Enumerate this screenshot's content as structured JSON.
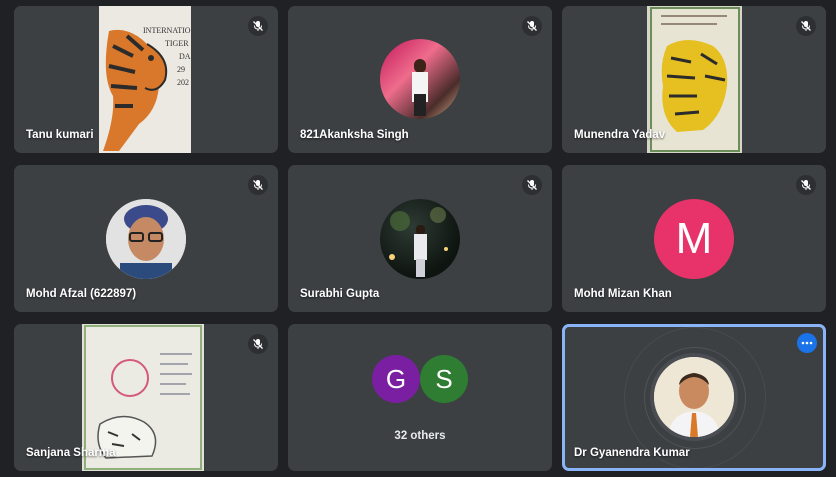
{
  "participants": [
    {
      "name": "Tanu kumari",
      "muted": true,
      "media": "drawing-tiger-poster"
    },
    {
      "name": "821Akanksha Singh",
      "muted": true,
      "media": "photo-avatar"
    },
    {
      "name": "Munendra Yadav",
      "muted": true,
      "media": "drawing-yellow-tiger"
    },
    {
      "name": "Mohd Afzal (622897)",
      "muted": true,
      "media": "photo-avatar"
    },
    {
      "name": "Surabhi Gupta",
      "muted": true,
      "media": "photo-avatar"
    },
    {
      "name": "Mohd Mizan Khan",
      "muted": true,
      "avatar_letter": "M",
      "avatar_color": "#e8336a"
    },
    {
      "name": "Sanjana Sharma",
      "muted": true,
      "media": "drawing-tiger-sketch"
    },
    {
      "name": "Dr Gyanendra Kumar",
      "muted": false,
      "active_speaker": true,
      "media": "photo-avatar"
    }
  ],
  "others_tile": {
    "label": "32 others",
    "avatars": [
      {
        "letter": "G",
        "color": "#7b1fa2"
      },
      {
        "letter": "S",
        "color": "#2e7d32"
      }
    ]
  },
  "poster_text": {
    "line1": "INTERNATIO",
    "line2": "TIGER",
    "line3": "DA",
    "line4": "29",
    "line5": "202"
  },
  "colors": {
    "background": "#202124",
    "tile": "#3c4043",
    "active_outline": "#8ab4f8",
    "more_button": "#1a73e8"
  },
  "icons": {
    "mute": "mic-off-icon",
    "more": "more-options-icon"
  }
}
